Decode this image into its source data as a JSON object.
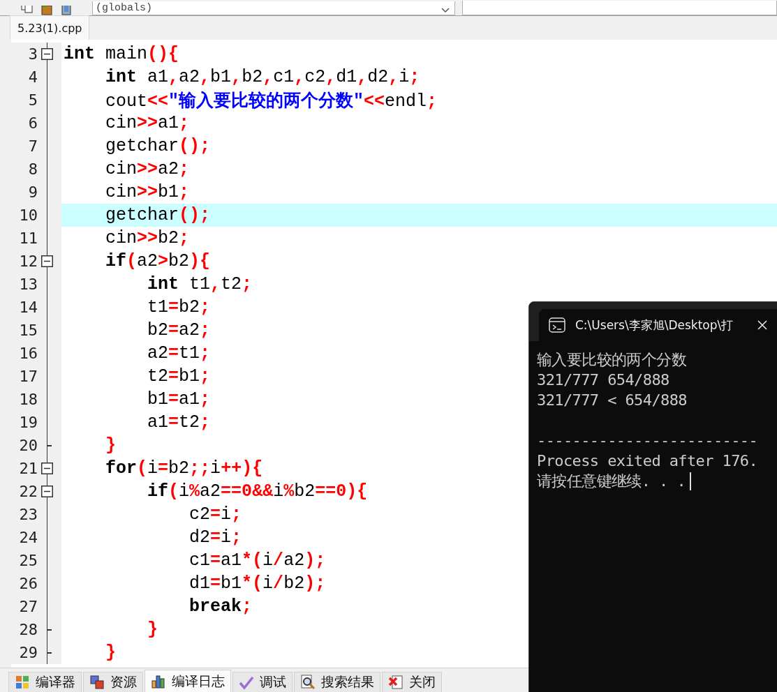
{
  "toolbar": {
    "scope_dropdown": {
      "value": "(globals)"
    }
  },
  "file_tabs": [
    {
      "label": "5.23(1).cpp",
      "selected": true
    }
  ],
  "editor": {
    "lines": [
      {
        "number": "3",
        "fold_toggle": true,
        "fold_end": false,
        "highlighted": false,
        "tokens": [
          {
            "kind": "keyword",
            "text": "int"
          },
          {
            "kind": "plain",
            "text": " main"
          },
          {
            "kind": "punct",
            "text": "(){"
          }
        ]
      },
      {
        "number": "4",
        "fold_toggle": false,
        "fold_end": false,
        "highlighted": false,
        "tokens": [
          {
            "kind": "keyword",
            "text": "    int"
          },
          {
            "kind": "plain",
            "text": " a1"
          },
          {
            "kind": "punct",
            "text": ","
          },
          {
            "kind": "plain",
            "text": "a2"
          },
          {
            "kind": "punct",
            "text": ","
          },
          {
            "kind": "plain",
            "text": "b1"
          },
          {
            "kind": "punct",
            "text": ","
          },
          {
            "kind": "plain",
            "text": "b2"
          },
          {
            "kind": "punct",
            "text": ","
          },
          {
            "kind": "plain",
            "text": "c1"
          },
          {
            "kind": "punct",
            "text": ","
          },
          {
            "kind": "plain",
            "text": "c2"
          },
          {
            "kind": "punct",
            "text": ","
          },
          {
            "kind": "plain",
            "text": "d1"
          },
          {
            "kind": "punct",
            "text": ","
          },
          {
            "kind": "plain",
            "text": "d2"
          },
          {
            "kind": "punct",
            "text": ","
          },
          {
            "kind": "plain",
            "text": "i"
          },
          {
            "kind": "punct",
            "text": ";"
          }
        ]
      },
      {
        "number": "5",
        "fold_toggle": false,
        "fold_end": false,
        "highlighted": false,
        "tokens": [
          {
            "kind": "plain",
            "text": "    cout"
          },
          {
            "kind": "punct",
            "text": "<<"
          },
          {
            "kind": "string",
            "text": "\"输入要比较的两个分数\""
          },
          {
            "kind": "punct",
            "text": "<<"
          },
          {
            "kind": "plain",
            "text": "endl"
          },
          {
            "kind": "punct",
            "text": ";"
          }
        ]
      },
      {
        "number": "6",
        "fold_toggle": false,
        "fold_end": false,
        "highlighted": false,
        "tokens": [
          {
            "kind": "plain",
            "text": "    cin"
          },
          {
            "kind": "punct",
            "text": ">>"
          },
          {
            "kind": "plain",
            "text": "a1"
          },
          {
            "kind": "punct",
            "text": ";"
          }
        ]
      },
      {
        "number": "7",
        "fold_toggle": false,
        "fold_end": false,
        "highlighted": false,
        "tokens": [
          {
            "kind": "plain",
            "text": "    getchar"
          },
          {
            "kind": "punct",
            "text": "();"
          }
        ]
      },
      {
        "number": "8",
        "fold_toggle": false,
        "fold_end": false,
        "highlighted": false,
        "tokens": [
          {
            "kind": "plain",
            "text": "    cin"
          },
          {
            "kind": "punct",
            "text": ">>"
          },
          {
            "kind": "plain",
            "text": "a2"
          },
          {
            "kind": "punct",
            "text": ";"
          }
        ]
      },
      {
        "number": "9",
        "fold_toggle": false,
        "fold_end": false,
        "highlighted": false,
        "tokens": [
          {
            "kind": "plain",
            "text": "    cin"
          },
          {
            "kind": "punct",
            "text": ">>"
          },
          {
            "kind": "plain",
            "text": "b1"
          },
          {
            "kind": "punct",
            "text": ";"
          }
        ]
      },
      {
        "number": "10",
        "fold_toggle": false,
        "fold_end": false,
        "highlighted": true,
        "tokens": [
          {
            "kind": "plain",
            "text": "    getchar"
          },
          {
            "kind": "punct",
            "text": "();"
          }
        ]
      },
      {
        "number": "11",
        "fold_toggle": false,
        "fold_end": false,
        "highlighted": false,
        "tokens": [
          {
            "kind": "plain",
            "text": "    cin"
          },
          {
            "kind": "punct",
            "text": ">>"
          },
          {
            "kind": "plain",
            "text": "b2"
          },
          {
            "kind": "punct",
            "text": ";"
          }
        ]
      },
      {
        "number": "12",
        "fold_toggle": true,
        "fold_end": false,
        "highlighted": false,
        "tokens": [
          {
            "kind": "keyword",
            "text": "    if"
          },
          {
            "kind": "punct",
            "text": "("
          },
          {
            "kind": "plain",
            "text": "a2"
          },
          {
            "kind": "punct",
            "text": ">"
          },
          {
            "kind": "plain",
            "text": "b2"
          },
          {
            "kind": "punct",
            "text": "){"
          }
        ]
      },
      {
        "number": "13",
        "fold_toggle": false,
        "fold_end": false,
        "highlighted": false,
        "tokens": [
          {
            "kind": "keyword",
            "text": "        int"
          },
          {
            "kind": "plain",
            "text": " t1"
          },
          {
            "kind": "punct",
            "text": ","
          },
          {
            "kind": "plain",
            "text": "t2"
          },
          {
            "kind": "punct",
            "text": ";"
          }
        ]
      },
      {
        "number": "14",
        "fold_toggle": false,
        "fold_end": false,
        "highlighted": false,
        "tokens": [
          {
            "kind": "plain",
            "text": "        t1"
          },
          {
            "kind": "punct",
            "text": "="
          },
          {
            "kind": "plain",
            "text": "b2"
          },
          {
            "kind": "punct",
            "text": ";"
          }
        ]
      },
      {
        "number": "15",
        "fold_toggle": false,
        "fold_end": false,
        "highlighted": false,
        "tokens": [
          {
            "kind": "plain",
            "text": "        b2"
          },
          {
            "kind": "punct",
            "text": "="
          },
          {
            "kind": "plain",
            "text": "a2"
          },
          {
            "kind": "punct",
            "text": ";"
          }
        ]
      },
      {
        "number": "16",
        "fold_toggle": false,
        "fold_end": false,
        "highlighted": false,
        "tokens": [
          {
            "kind": "plain",
            "text": "        a2"
          },
          {
            "kind": "punct",
            "text": "="
          },
          {
            "kind": "plain",
            "text": "t1"
          },
          {
            "kind": "punct",
            "text": ";"
          }
        ]
      },
      {
        "number": "17",
        "fold_toggle": false,
        "fold_end": false,
        "highlighted": false,
        "tokens": [
          {
            "kind": "plain",
            "text": "        t2"
          },
          {
            "kind": "punct",
            "text": "="
          },
          {
            "kind": "plain",
            "text": "b1"
          },
          {
            "kind": "punct",
            "text": ";"
          }
        ]
      },
      {
        "number": "18",
        "fold_toggle": false,
        "fold_end": false,
        "highlighted": false,
        "tokens": [
          {
            "kind": "plain",
            "text": "        b1"
          },
          {
            "kind": "punct",
            "text": "="
          },
          {
            "kind": "plain",
            "text": "a1"
          },
          {
            "kind": "punct",
            "text": ";"
          }
        ]
      },
      {
        "number": "19",
        "fold_toggle": false,
        "fold_end": false,
        "highlighted": false,
        "tokens": [
          {
            "kind": "plain",
            "text": "        a1"
          },
          {
            "kind": "punct",
            "text": "="
          },
          {
            "kind": "plain",
            "text": "t2"
          },
          {
            "kind": "punct",
            "text": ";"
          }
        ]
      },
      {
        "number": "20",
        "fold_toggle": false,
        "fold_end": true,
        "highlighted": false,
        "tokens": [
          {
            "kind": "punct",
            "text": "    }"
          }
        ]
      },
      {
        "number": "21",
        "fold_toggle": true,
        "fold_end": false,
        "highlighted": false,
        "tokens": [
          {
            "kind": "keyword",
            "text": "    for"
          },
          {
            "kind": "punct",
            "text": "("
          },
          {
            "kind": "plain",
            "text": "i"
          },
          {
            "kind": "punct",
            "text": "="
          },
          {
            "kind": "plain",
            "text": "b2"
          },
          {
            "kind": "punct",
            "text": ";;"
          },
          {
            "kind": "plain",
            "text": "i"
          },
          {
            "kind": "punct",
            "text": "++){"
          }
        ]
      },
      {
        "number": "22",
        "fold_toggle": true,
        "fold_end": false,
        "highlighted": false,
        "tokens": [
          {
            "kind": "keyword",
            "text": "        if"
          },
          {
            "kind": "punct",
            "text": "("
          },
          {
            "kind": "plain",
            "text": "i"
          },
          {
            "kind": "punct",
            "text": "%"
          },
          {
            "kind": "plain",
            "text": "a2"
          },
          {
            "kind": "punct",
            "text": "=="
          },
          {
            "kind": "number",
            "text": "0"
          },
          {
            "kind": "punct",
            "text": "&&"
          },
          {
            "kind": "plain",
            "text": "i"
          },
          {
            "kind": "punct",
            "text": "%"
          },
          {
            "kind": "plain",
            "text": "b2"
          },
          {
            "kind": "punct",
            "text": "=="
          },
          {
            "kind": "number",
            "text": "0"
          },
          {
            "kind": "punct",
            "text": "){"
          }
        ]
      },
      {
        "number": "23",
        "fold_toggle": false,
        "fold_end": false,
        "highlighted": false,
        "tokens": [
          {
            "kind": "plain",
            "text": "            c2"
          },
          {
            "kind": "punct",
            "text": "="
          },
          {
            "kind": "plain",
            "text": "i"
          },
          {
            "kind": "punct",
            "text": ";"
          }
        ]
      },
      {
        "number": "24",
        "fold_toggle": false,
        "fold_end": false,
        "highlighted": false,
        "tokens": [
          {
            "kind": "plain",
            "text": "            d2"
          },
          {
            "kind": "punct",
            "text": "="
          },
          {
            "kind": "plain",
            "text": "i"
          },
          {
            "kind": "punct",
            "text": ";"
          }
        ]
      },
      {
        "number": "25",
        "fold_toggle": false,
        "fold_end": false,
        "highlighted": false,
        "tokens": [
          {
            "kind": "plain",
            "text": "            c1"
          },
          {
            "kind": "punct",
            "text": "="
          },
          {
            "kind": "plain",
            "text": "a1"
          },
          {
            "kind": "punct",
            "text": "*("
          },
          {
            "kind": "plain",
            "text": "i"
          },
          {
            "kind": "punct",
            "text": "/"
          },
          {
            "kind": "plain",
            "text": "a2"
          },
          {
            "kind": "punct",
            "text": ");"
          }
        ]
      },
      {
        "number": "26",
        "fold_toggle": false,
        "fold_end": false,
        "highlighted": false,
        "tokens": [
          {
            "kind": "plain",
            "text": "            d1"
          },
          {
            "kind": "punct",
            "text": "="
          },
          {
            "kind": "plain",
            "text": "b1"
          },
          {
            "kind": "punct",
            "text": "*("
          },
          {
            "kind": "plain",
            "text": "i"
          },
          {
            "kind": "punct",
            "text": "/"
          },
          {
            "kind": "plain",
            "text": "b2"
          },
          {
            "kind": "punct",
            "text": ");"
          }
        ]
      },
      {
        "number": "27",
        "fold_toggle": false,
        "fold_end": false,
        "highlighted": false,
        "tokens": [
          {
            "kind": "keyword",
            "text": "            break"
          },
          {
            "kind": "punct",
            "text": ";"
          }
        ]
      },
      {
        "number": "28",
        "fold_toggle": false,
        "fold_end": true,
        "highlighted": false,
        "tokens": [
          {
            "kind": "punct",
            "text": "        }"
          }
        ]
      },
      {
        "number": "29",
        "fold_toggle": false,
        "fold_end": true,
        "highlighted": false,
        "tokens": [
          {
            "kind": "punct",
            "text": "    }"
          }
        ]
      }
    ]
  },
  "bottom_tabs": [
    {
      "label": "编译器",
      "kind": "grid",
      "selected": false
    },
    {
      "label": "资源",
      "kind": "squares",
      "selected": false
    },
    {
      "label": "编译日志",
      "kind": "bars",
      "selected": true
    },
    {
      "label": "调试",
      "kind": "check",
      "selected": false
    },
    {
      "label": "搜索结果",
      "kind": "magnifier",
      "selected": false
    },
    {
      "label": "关闭",
      "kind": "close",
      "selected": false
    }
  ],
  "console": {
    "title": "C:\\Users\\李家旭\\Desktop\\打",
    "lines": [
      {
        "text": "输入要比较的两个分数",
        "blank_before": false
      },
      {
        "text": "321/777 654/888",
        "blank_before": false
      },
      {
        "text": "321/777 < 654/888",
        "blank_before": false
      },
      {
        "text": "-------------------------",
        "blank_before": true
      },
      {
        "text": "Process exited after 176.",
        "blank_before": false
      },
      {
        "text": "请按任意键继续. . .",
        "blank_before": false
      }
    ]
  }
}
